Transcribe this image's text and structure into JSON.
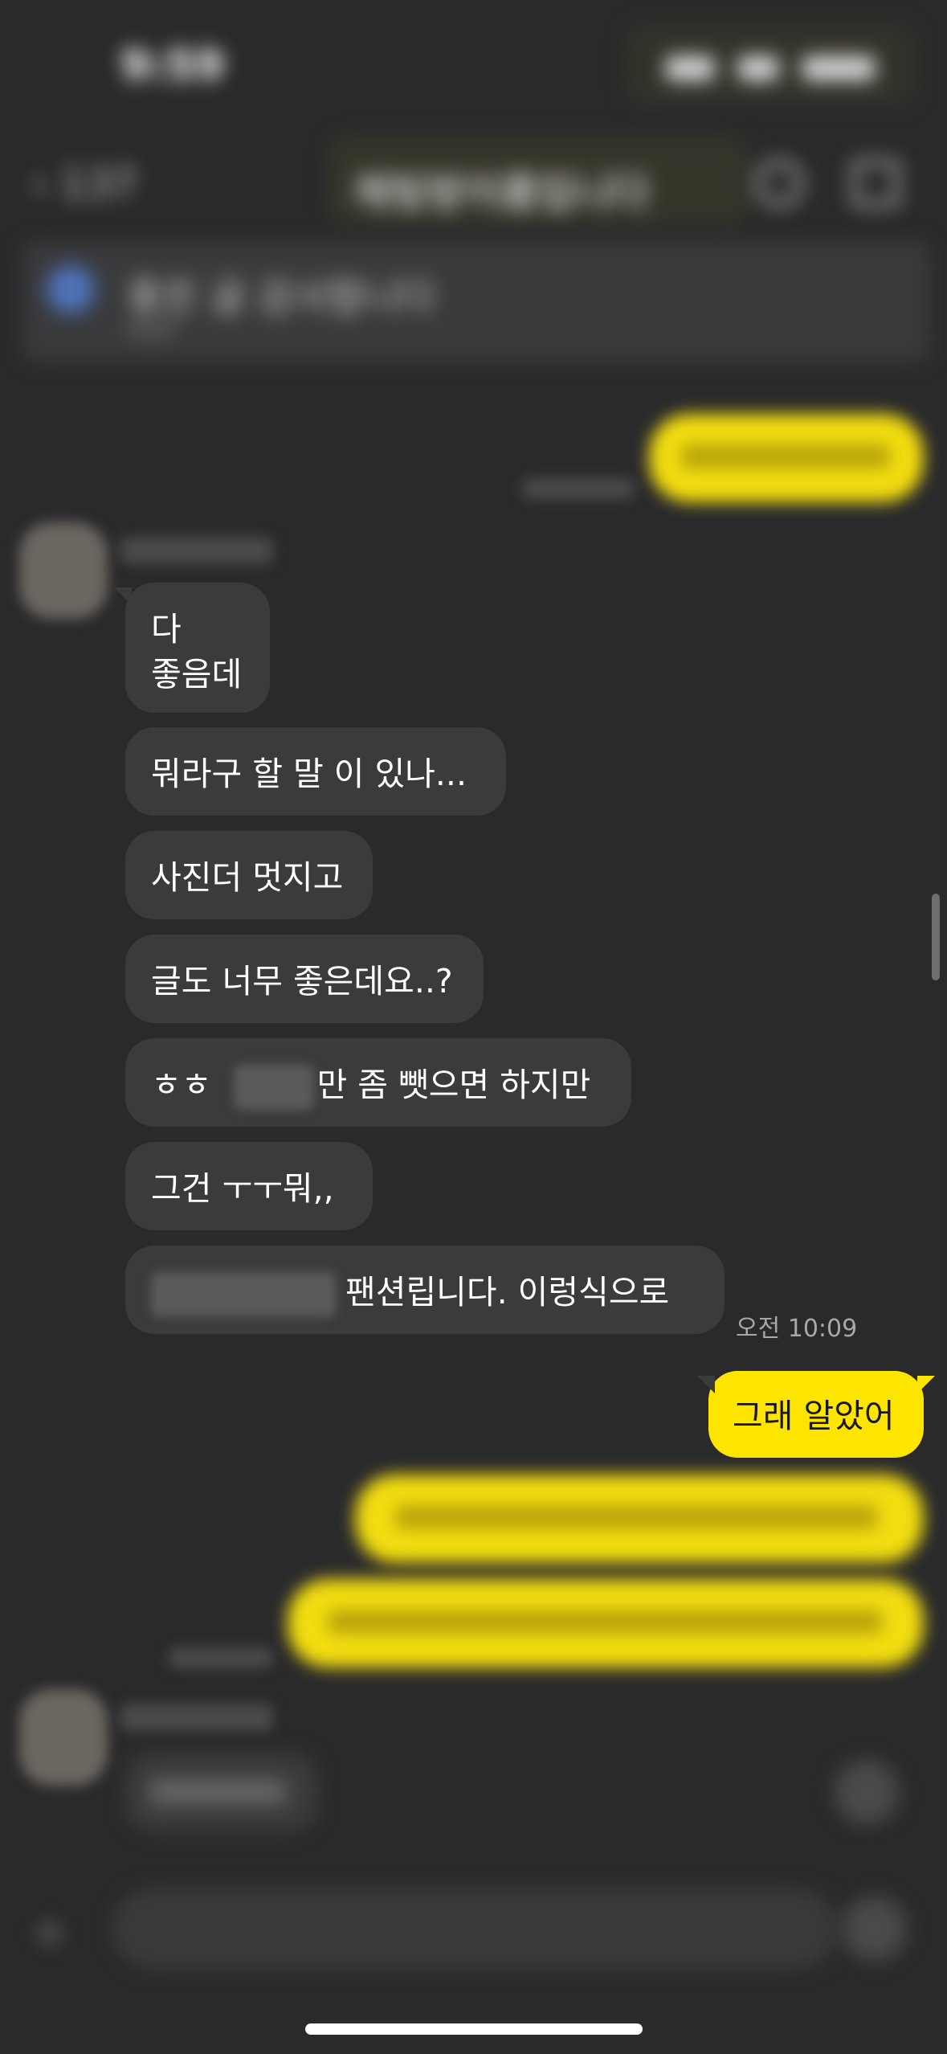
{
  "status_bar": {
    "time": "9:59"
  },
  "nav": {
    "back_label": "‹ 137",
    "title": "채팅방이름입니다"
  },
  "notice": {
    "text": "좋은 글 감사합니다"
  },
  "messages": {
    "m1_line1": "다",
    "m1_line2": "좋음데",
    "m2": "뭐라구 할 말 이 있나...",
    "m3": "사진더 멋지고",
    "m4": "글도 너무 좋은데요..?",
    "m5_prefix": "ㅎㅎ",
    "m5_suffix": "만 좀 뺏으면 하지만",
    "m6": "그건 ㅜㅜ뭐,,",
    "m7_suffix": "팬션립니다. 이렁식으로",
    "time_incoming": "오전 10:09",
    "mine_1": "그래 알았어"
  },
  "colors": {
    "background": "#2a2a2c",
    "incoming_bubble": "#3b3b3d",
    "outgoing_bubble": "#fee500"
  }
}
